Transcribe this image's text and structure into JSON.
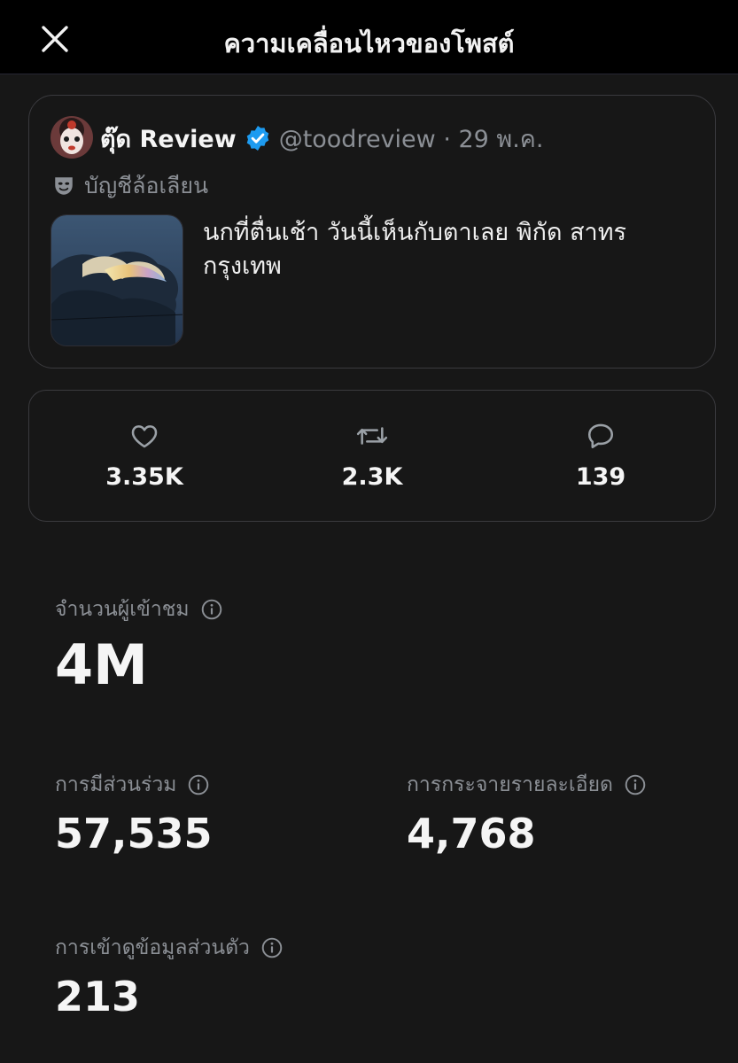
{
  "header": {
    "title": "ความเคลื่อนไหวของโพสต์",
    "close_icon": "close-icon"
  },
  "post": {
    "author_name": "ตุ๊ด Review",
    "handle_date": "@toodreview · 29 พ.ค.",
    "parody_label": "บัญชีล้อเลียน",
    "text_line1": "นกที่ตื่นเช้า วันนี้เห็นกับตาเลย พิกัด สาทร",
    "text_line2": "กรุงเทพ",
    "verified_color": "#1d9bf0"
  },
  "engagement": {
    "likes": "3.35K",
    "reposts": "2.3K",
    "replies": "139"
  },
  "metrics": {
    "impressions_label": "จำนวนผู้เข้าชม",
    "impressions_value": "4M",
    "engagements_label": "การมีส่วนร่วม",
    "engagements_value": "57,535",
    "detail_expands_label": "การกระจายรายละเอียด",
    "detail_expands_value": "4,768",
    "profile_visits_label": "การเข้าดูข้อมูลส่วนตัว",
    "profile_visits_value": "213"
  },
  "colors": {
    "background": "#171717",
    "header_bg": "#000000",
    "secondary_text": "#8b8f95",
    "card_border": "#3a3a3e"
  }
}
